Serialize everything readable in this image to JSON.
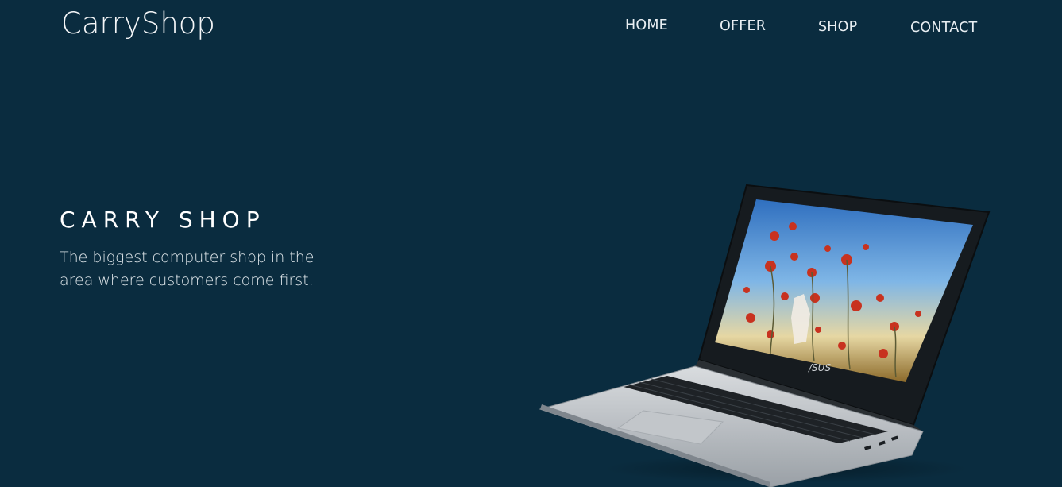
{
  "header": {
    "brand": "CarryShop",
    "nav": [
      {
        "label": "HOME"
      },
      {
        "label": "OFFER"
      },
      {
        "label": "SHOP"
      },
      {
        "label": "CONTACT"
      }
    ]
  },
  "hero": {
    "title": "CARRY SHOP",
    "description": "The biggest computer shop in the area where customers come first.",
    "laptop_logo": "/SUS"
  },
  "colors": {
    "background": "#0a2c3f",
    "text": "#ffffff"
  },
  "icons": [
    "laptop-image"
  ]
}
